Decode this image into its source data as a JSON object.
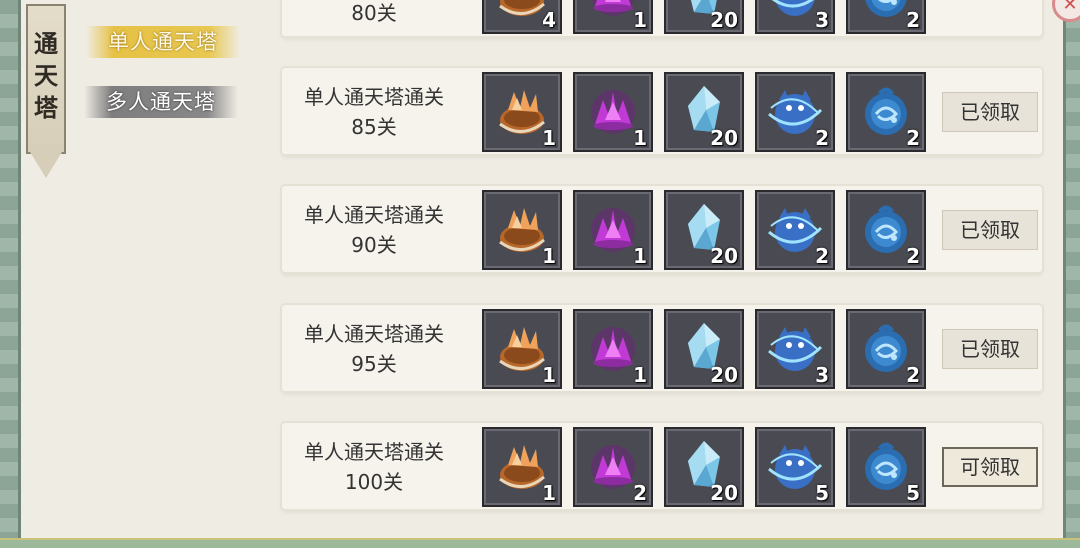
{
  "banner": {
    "chars": [
      "通",
      "天",
      "塔"
    ]
  },
  "tabs": [
    {
      "label": "单人通天塔",
      "active": true
    },
    {
      "label": "多人通天塔",
      "active": false
    }
  ],
  "close_icon": "close-icon",
  "item_icons": [
    "orange-lotus-pouch-icon",
    "purple-lotus-crystal-icon",
    "blue-crystal-shard-icon",
    "blue-beast-orb-icon",
    "blue-spirit-orb-icon"
  ],
  "partial_row": {
    "title": "80关",
    "counts": [
      "4",
      "1",
      "20",
      "3",
      "2"
    ]
  },
  "rows": [
    {
      "title": "单人通天塔通关",
      "level": "85关",
      "counts": [
        "1",
        "1",
        "20",
        "2",
        "2"
      ],
      "button": "已领取"
    },
    {
      "title": "单人通天塔通关",
      "level": "90关",
      "counts": [
        "1",
        "1",
        "20",
        "2",
        "2"
      ],
      "button": "已领取"
    },
    {
      "title": "单人通天塔通关",
      "level": "95关",
      "counts": [
        "1",
        "1",
        "20",
        "3",
        "2"
      ],
      "button": "已领取"
    },
    {
      "title": "单人通天塔通关",
      "level": "100关",
      "counts": [
        "1",
        "2",
        "20",
        "5",
        "5"
      ],
      "button": "可领取"
    }
  ],
  "colors": {
    "active_tab": "#e6c145",
    "inactive_tab": "#858585",
    "frame": "#8da597"
  }
}
